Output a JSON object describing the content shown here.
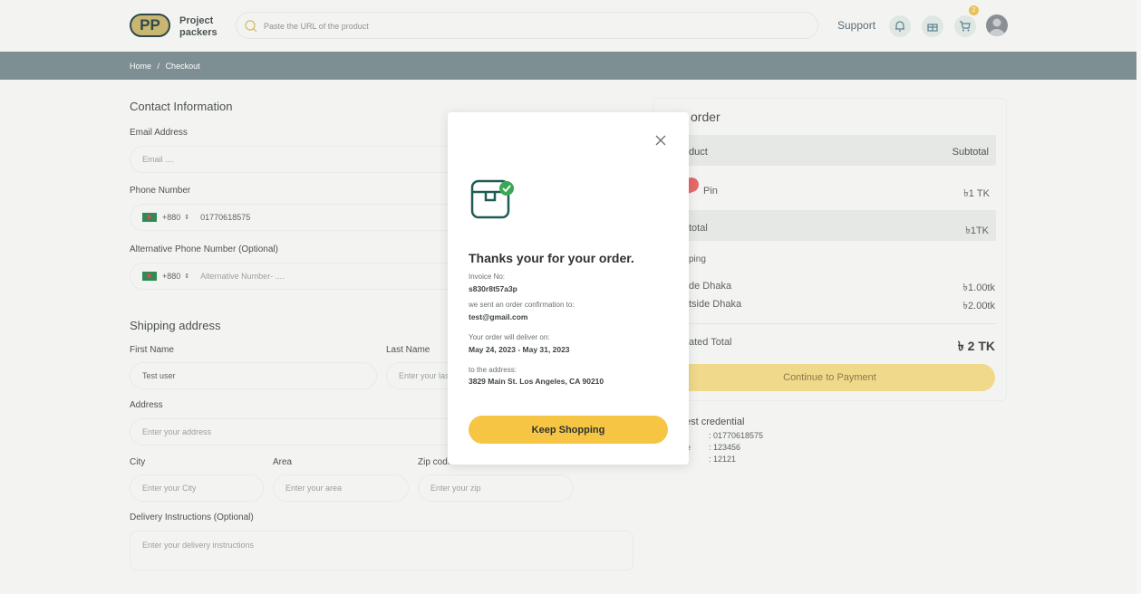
{
  "header": {
    "logo_mark": "PP",
    "logo_line1": "Project",
    "logo_line2": "packers",
    "search_placeholder": "Paste the URL of the product",
    "support_label": "Support",
    "cart_count": "2"
  },
  "breadcrumb": {
    "home": "Home",
    "separator": "/",
    "current": "Checkout"
  },
  "contact": {
    "title": "Contact Information",
    "email_label": "Email Address",
    "email_placeholder": "Email ....",
    "phone_label": "Phone Number",
    "phone_code": "+880",
    "phone_value": "01770618575",
    "alt_phone_label": "Alternative Phone Number (Optional)",
    "alt_phone_code": "+880",
    "alt_phone_placeholder": "Alternative Number- ...."
  },
  "shipping": {
    "title": "Shipping address",
    "first_name_label": "First Name",
    "first_name_value": "Test user",
    "last_name_label": "Last Name",
    "last_name_placeholder": "Enter your las",
    "address_label": "Address",
    "address_placeholder": "Enter your address",
    "city_label": "City",
    "city_placeholder": "Enter your City",
    "area_label": "Area",
    "area_placeholder": "Enter your area",
    "zip_label": "Zip code",
    "zip_placeholder": "Enter your zip",
    "instructions_label": "Delivery Instructions (Optional)",
    "instructions_placeholder": "Enter your delivery instructions"
  },
  "order": {
    "title": "order",
    "col_product": "duct",
    "col_subtotal": "Subtotal",
    "item_name": "Pin",
    "item_price": "৳1 TK",
    "subtotal_label": "total",
    "subtotal_value": "৳1TK",
    "shipping_label": "ping",
    "inside_label": "de Dhaka",
    "inside_value": "৳1.00tk",
    "outside_label": "tside Dhaka",
    "outside_value": "৳2.00tk",
    "estimated_label": "ated Total",
    "estimated_value": "৳ 2 TK",
    "continue_label": "Continue to Payment"
  },
  "credential": {
    "title": "est credential",
    "row1_key": "",
    "row1_value": ": 01770618575",
    "row2_key": "e",
    "row2_value": ": 123456",
    "row3_value": ": 12121"
  },
  "modal": {
    "heading": "Thanks your for your order.",
    "invoice_label": "Invoice No:",
    "invoice_value": "s830r8t57a3p",
    "sent_label": "we sent an order confirmation to:",
    "sent_value": "test@gmail.com",
    "deliver_label": "Your order will deliver on:",
    "deliver_value": "May 24, 2023 - May 31, 2023",
    "address_label": "to the address:",
    "address_value": "3829 Main St. Los Angeles, CA 90210",
    "keep_label": "Keep Shopping"
  },
  "colors": {
    "accent": "#f5c543",
    "crumb_bar": "#7e8f93",
    "icon_teal": "#1f5b55",
    "check_green": "#3aa856"
  }
}
